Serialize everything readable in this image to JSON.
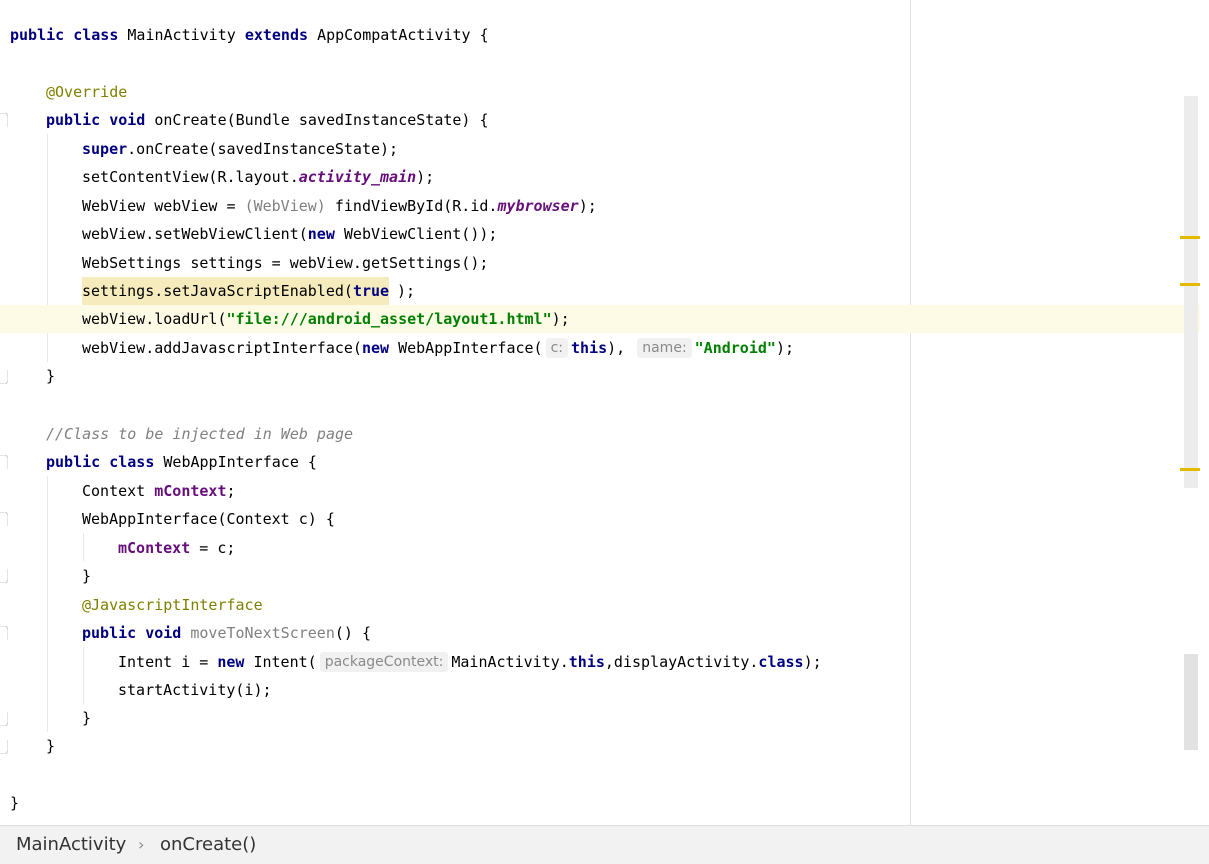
{
  "editor": {
    "lines": {
      "l1": {
        "kw1": "public class ",
        "name": "MainActivity ",
        "kw2": "extends ",
        "base": "AppCompatActivity {"
      },
      "l3": {
        "ann": "@Override"
      },
      "l4": {
        "kw": "public void ",
        "rest": "onCreate(Bundle savedInstanceState) {"
      },
      "l5": {
        "kw": "super",
        "rest": ".onCreate(savedInstanceState);"
      },
      "l6": {
        "pre": "setContentView(R.layout.",
        "fld": "activity_main",
        "post": ");"
      },
      "l7": {
        "pre": "WebView webView = ",
        "cast": "(WebView)",
        "mid": " findViewById(R.id.",
        "fld": "mybrowser",
        "post": ");"
      },
      "l8": {
        "pre": "webView.setWebViewClient(",
        "kw": "new",
        "post": " WebViewClient());"
      },
      "l9": {
        "text": "WebSettings settings = webView.getSettings();"
      },
      "l10": {
        "pre": "settings.setJavaScriptEnabled(",
        "kw": "true",
        "post": ");"
      },
      "l11": {
        "pre": "webView.loadUrl(",
        "str": "\"file:///android_asset/layout1.html\"",
        "post": ");"
      },
      "l12": {
        "pre": "webView.addJavascriptInterface(",
        "kw": "new",
        "mid": " WebAppInterface(",
        "hint1": "c:",
        "kw2": "this",
        "mid2": "),",
        "hint2": "name:",
        "str": "\"Android\"",
        "post": ");"
      },
      "l13": {
        "text": "}"
      },
      "l15": {
        "cmt": "//Class to be injected in Web page"
      },
      "l16": {
        "kw": "public class ",
        "rest": "WebAppInterface {"
      },
      "l17": {
        "pre": "Context ",
        "fld": "mContext",
        "post": ";"
      },
      "l18": {
        "text": "WebAppInterface(Context c) {"
      },
      "l19": {
        "fld": "mContext",
        "post": " = c;"
      },
      "l20": {
        "text": "}"
      },
      "l21": {
        "ann": "@JavascriptInterface"
      },
      "l22": {
        "kw": "public void ",
        "dim": "moveToNextScreen",
        "post": "() {"
      },
      "l23": {
        "pre": "Intent i = ",
        "kw": "new",
        "mid": " Intent(",
        "hint": "packageContext:",
        "mid2": "MainActivity.",
        "kw2": "this",
        "mid3": ",displayActivity.",
        "kw3": "class",
        "post": ");"
      },
      "l24": {
        "text": "startActivity(i);"
      },
      "l25": {
        "text": "}"
      },
      "l26": {
        "text": "}"
      },
      "l28": {
        "text": "}"
      }
    }
  },
  "breadcrumb": {
    "class_name": "MainActivity",
    "separator": "›",
    "method_name": "onCreate()"
  },
  "colors": {
    "keyword": "#000080",
    "annotation": "#808000",
    "string": "#008000",
    "field": "#660e7a",
    "comment": "#808080",
    "caret_row": "#fdfae6",
    "marker": "#e6b800"
  }
}
